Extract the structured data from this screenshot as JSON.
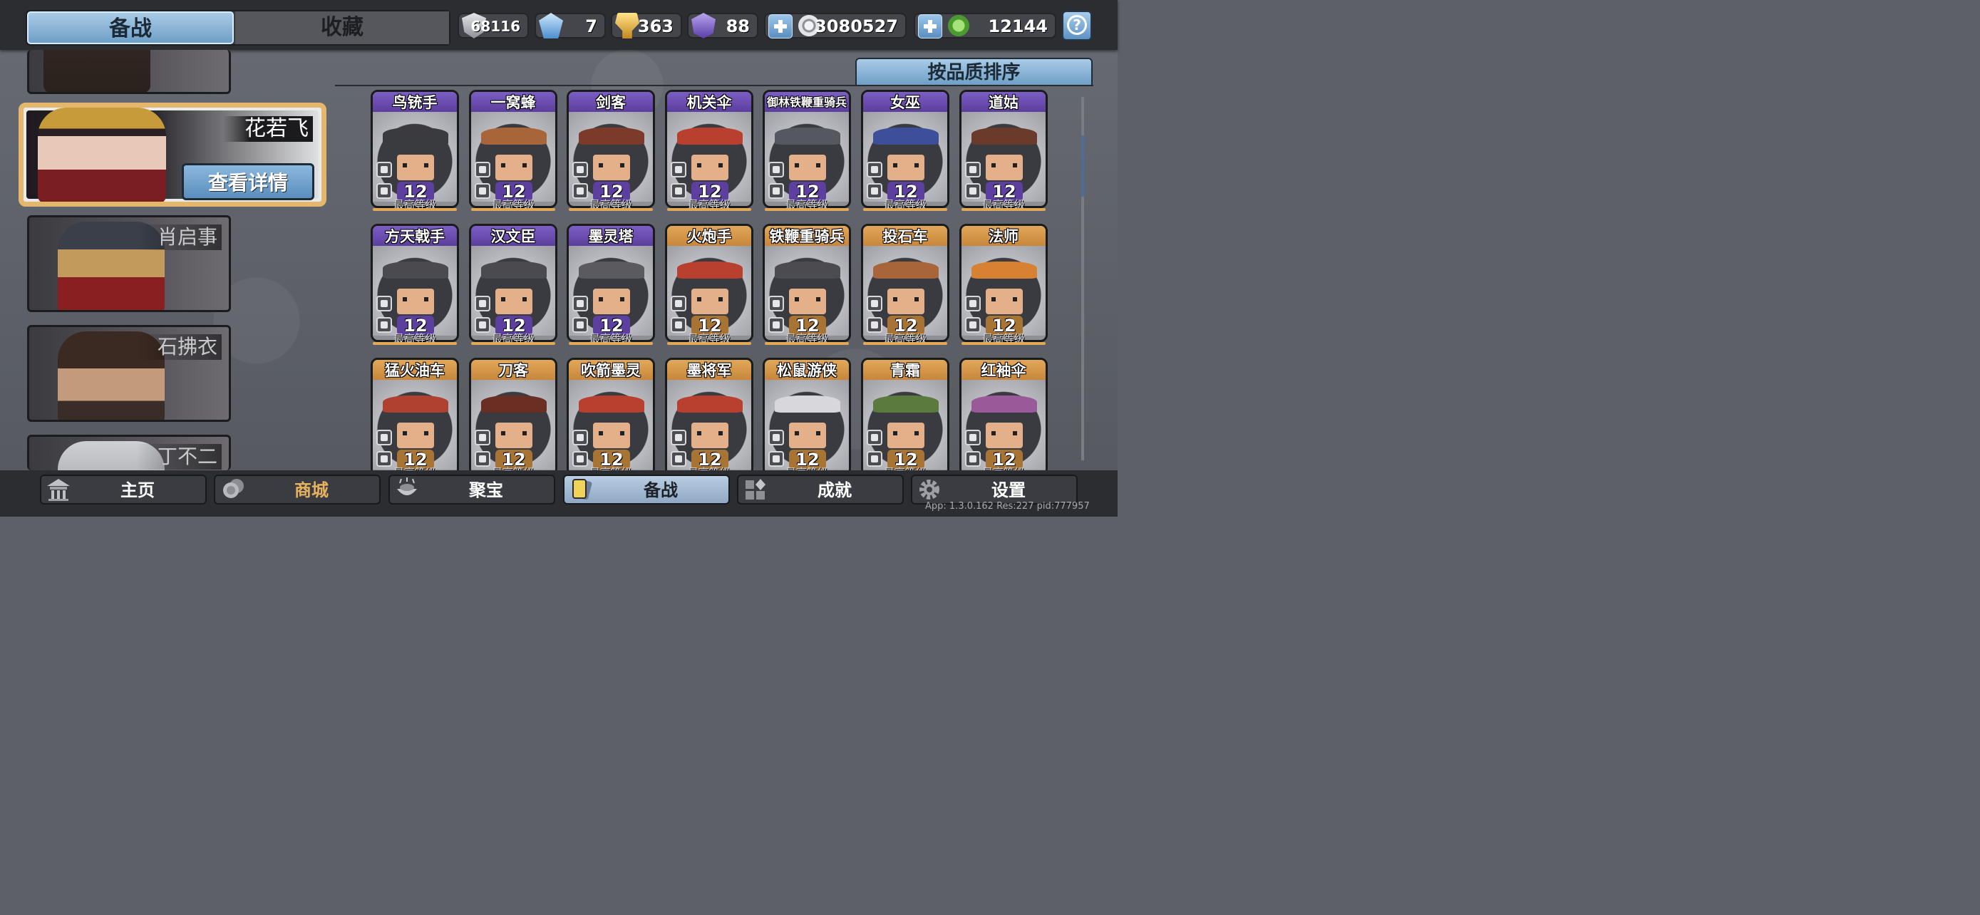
{
  "tabs": {
    "active": "备战",
    "inactive": "收藏"
  },
  "resources": [
    {
      "icon": "silver-shield-icon",
      "value": "68116",
      "color": "#b8bcc4"
    },
    {
      "icon": "blue-crystal-icon",
      "value": "7",
      "color": "#7fb6e6"
    },
    {
      "icon": "gold-trophy-icon",
      "value": "363",
      "color": "#e2b33c"
    },
    {
      "icon": "purple-gem-icon",
      "value": "88",
      "color": "#7b5cc6"
    },
    {
      "icon": "silver-coin-icon",
      "value": "3080527",
      "color": "#d5d7db"
    },
    {
      "icon": "jade-token-icon",
      "value": "12144",
      "color": "#6bb24a"
    }
  ],
  "heroes": [
    {
      "name": "",
      "state": "partial"
    },
    {
      "name": "花若飞",
      "state": "selected",
      "button": "查看详情"
    },
    {
      "name": "肖启事",
      "state": "normal"
    },
    {
      "name": "石拂衣",
      "state": "normal"
    },
    {
      "name": "丁不二",
      "state": "partial"
    }
  ],
  "sort_button": "按品质排序",
  "max_level_label": "最高等级",
  "units": [
    {
      "name": "鸟铳手",
      "rarity": "purple",
      "level": "12"
    },
    {
      "name": "一窝蜂",
      "rarity": "purple",
      "level": "12"
    },
    {
      "name": "剑客",
      "rarity": "purple",
      "level": "12"
    },
    {
      "name": "机关伞",
      "rarity": "purple",
      "level": "12"
    },
    {
      "name": "御林铁鞭重骑兵",
      "rarity": "purple",
      "level": "12"
    },
    {
      "name": "女巫",
      "rarity": "purple",
      "level": "12"
    },
    {
      "name": "道姑",
      "rarity": "purple",
      "level": "12"
    },
    {
      "name": "方天戟手",
      "rarity": "purple",
      "level": "12"
    },
    {
      "name": "汉文臣",
      "rarity": "purple",
      "level": "12"
    },
    {
      "name": "墨灵塔",
      "rarity": "purple",
      "level": "12"
    },
    {
      "name": "火炮手",
      "rarity": "gold",
      "level": "12"
    },
    {
      "name": "铁鞭重骑兵",
      "rarity": "gold",
      "level": "12"
    },
    {
      "name": "投石车",
      "rarity": "gold",
      "level": "12"
    },
    {
      "name": "法师",
      "rarity": "gold",
      "level": "12"
    },
    {
      "name": "猛火油车",
      "rarity": "gold",
      "level": "12"
    },
    {
      "name": "刀客",
      "rarity": "gold",
      "level": "12"
    },
    {
      "name": "吹箭墨灵",
      "rarity": "gold",
      "level": "12"
    },
    {
      "name": "墨将军",
      "rarity": "gold",
      "level": "12"
    },
    {
      "name": "松鼠游侠",
      "rarity": "gold",
      "level": "12"
    },
    {
      "name": "青霜",
      "rarity": "gold",
      "level": "12"
    },
    {
      "name": "红袖伞",
      "rarity": "gold",
      "level": "12"
    }
  ],
  "nav": [
    {
      "label": "主页",
      "icon": "palace-icon"
    },
    {
      "label": "商城",
      "icon": "coins-icon"
    },
    {
      "label": "聚宝",
      "icon": "treasure-bowl-icon"
    },
    {
      "label": "备战",
      "icon": "cards-icon"
    },
    {
      "label": "成就",
      "icon": "achievement-icon"
    },
    {
      "label": "设置",
      "icon": "gear-icon"
    }
  ],
  "version": "App: 1.3.0.162 Res:227 pid:777957"
}
